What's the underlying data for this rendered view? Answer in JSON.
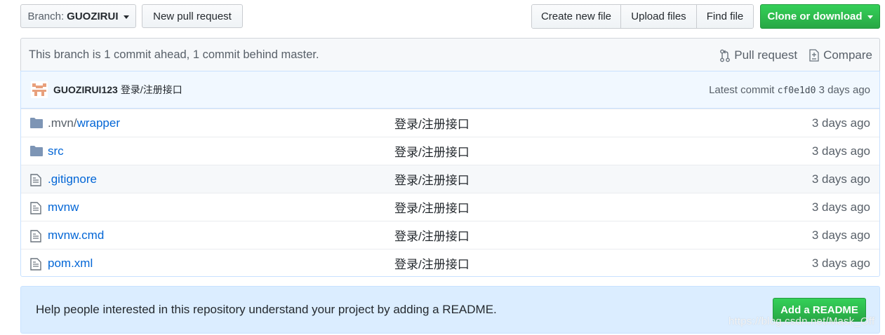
{
  "toolbar": {
    "branch_prefix": "Branch:",
    "branch_name": "GUOZIRUI",
    "new_pull_request": "New pull request",
    "create_new_file": "Create new file",
    "upload_files": "Upload files",
    "find_file": "Find file",
    "clone_or_download": "Clone or download"
  },
  "branch_info": {
    "status": "This branch is 1 commit ahead, 1 commit behind master.",
    "pull_request": "Pull request",
    "compare": "Compare"
  },
  "commit": {
    "author": "GUOZIRUI123",
    "message": "登录/注册接口",
    "latest_label": "Latest commit",
    "sha": "cf0e1d0",
    "age": "3 days ago"
  },
  "files": [
    {
      "type": "folder",
      "name_dim": ".mvn/",
      "name": "wrapper",
      "message": "登录/注册接口",
      "age": "3 days ago"
    },
    {
      "type": "folder",
      "name_dim": "",
      "name": "src",
      "message": "登录/注册接口",
      "age": "3 days ago"
    },
    {
      "type": "file",
      "name_dim": "",
      "name": ".gitignore",
      "message": "登录/注册接口",
      "age": "3 days ago"
    },
    {
      "type": "file",
      "name_dim": "",
      "name": "mvnw",
      "message": "登录/注册接口",
      "age": "3 days ago"
    },
    {
      "type": "file",
      "name_dim": "",
      "name": "mvnw.cmd",
      "message": "登录/注册接口",
      "age": "3 days ago"
    },
    {
      "type": "file",
      "name_dim": "",
      "name": "pom.xml",
      "message": "登录/注册接口",
      "age": "3 days ago"
    }
  ],
  "readme": {
    "text": "Help people interested in this repository understand your project by adding a README.",
    "button": "Add a README"
  },
  "watermark": "https://blog.csdn.net/Mask_Off",
  "colors": {
    "green": "#28a745",
    "link": "#0366d6",
    "muted": "#586069",
    "readme_bg": "#dbedff"
  }
}
